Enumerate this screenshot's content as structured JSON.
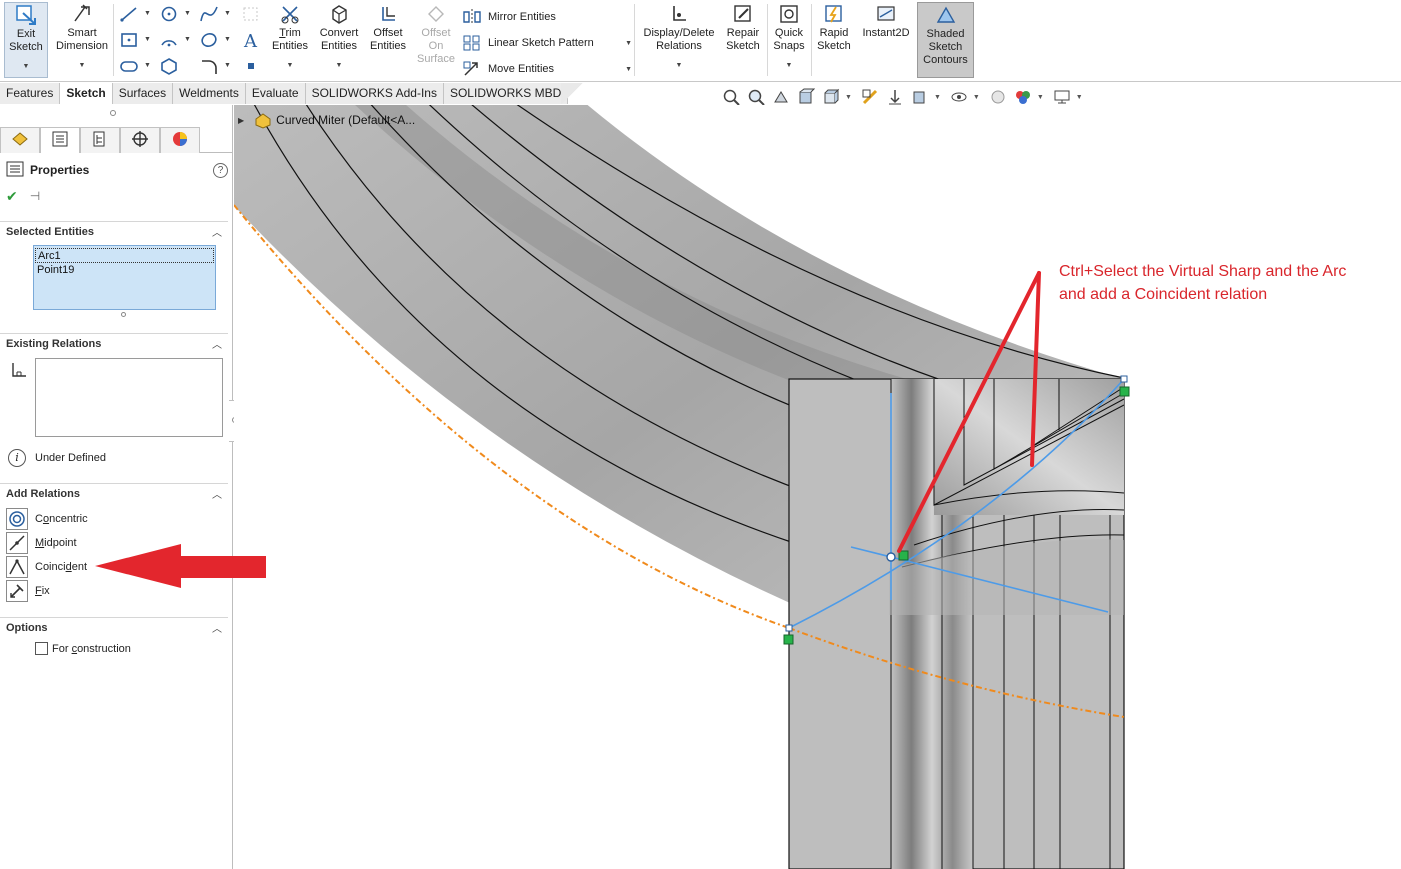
{
  "ribbon": {
    "exit_sketch": "Exit\nSketch",
    "smart_dimension": "Smart\nDimension",
    "trim_entities": "Trim\nEntities",
    "convert_entities": "Convert\nEntities",
    "offset_entities": "Offset\nEntities",
    "offset_on_surface": "Offset\nOn\nSurface",
    "mirror_entities": "Mirror Entities",
    "linear_sketch_pattern": "Linear Sketch Pattern",
    "move_entities": "Move Entities",
    "display_delete_relations": "Display/Delete\nRelations",
    "repair_sketch": "Repair\nSketch",
    "quick_snaps": "Quick\nSnaps",
    "rapid_sketch": "Rapid\nSketch",
    "instant2d": "Instant2D",
    "shaded_sketch_contours": "Shaded\nSketch\nContours"
  },
  "tabs": [
    "Features",
    "Sketch",
    "Surfaces",
    "Weldments",
    "Evaluate",
    "SOLIDWORKS Add-Ins",
    "SOLIDWORKS MBD"
  ],
  "active_tab": "Sketch",
  "panel": {
    "title": "Properties",
    "help": "?",
    "selected_entities": {
      "heading": "Selected Entities",
      "items": [
        "Arc1",
        "Point19"
      ]
    },
    "existing_relations": {
      "heading": "Existing Relations",
      "status": "Under Defined"
    },
    "add_relations": {
      "heading": "Add Relations",
      "items": [
        {
          "label_pre": "C",
          "label_u": "o",
          "label_post": "ncentric"
        },
        {
          "label_pre": "",
          "label_u": "M",
          "label_post": "idpoint"
        },
        {
          "label_pre": "Coinci",
          "label_u": "d",
          "label_post": "ent"
        },
        {
          "label_pre": "",
          "label_u": "F",
          "label_post": "ix"
        }
      ]
    },
    "options": {
      "heading": "Options",
      "for_construction_pre": "For ",
      "for_construction_u": "c",
      "for_construction_post": "onstruction"
    }
  },
  "tree": {
    "root_label": "Curved Miter  (Default<A..."
  },
  "annotation": {
    "text": "Ctrl+Select the Virtual Sharp and the Arc and add a Coincident relation"
  },
  "colors": {
    "accent_red": "#e3262d",
    "sketch_blue": "#4d9be8",
    "edge_orange": "#f08a1c",
    "point_green": "#27b34a"
  }
}
